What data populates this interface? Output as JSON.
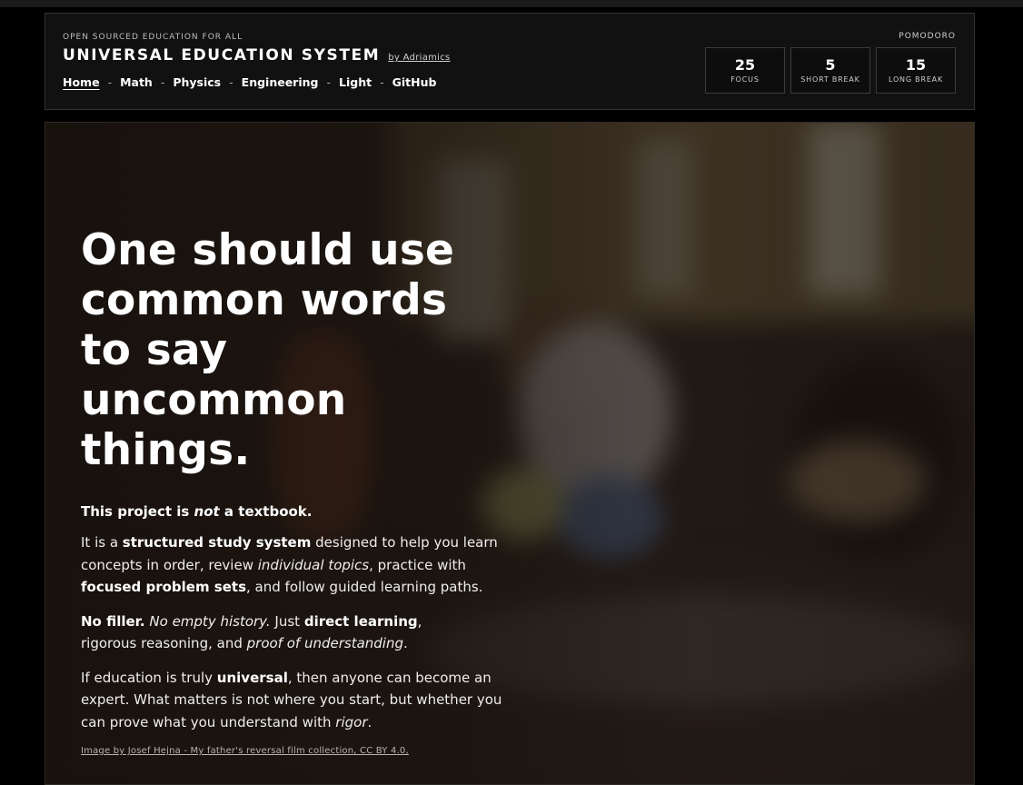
{
  "header": {
    "kicker": "OPEN SOURCED EDUCATION FOR ALL",
    "title": "UNIVERSAL EDUCATION SYSTEM",
    "byline": "by Adriamics",
    "nav": [
      {
        "label": "Home"
      },
      {
        "label": "Math"
      },
      {
        "label": "Physics"
      },
      {
        "label": "Engineering"
      },
      {
        "label": "Light"
      },
      {
        "label": "GitHub"
      }
    ],
    "nav_separator": "-"
  },
  "pomodoro": {
    "label": "POMODORO",
    "timers": [
      {
        "minutes": "25",
        "caption": "FOCUS"
      },
      {
        "minutes": "5",
        "caption": "SHORT BREAK"
      },
      {
        "minutes": "15",
        "caption": "LONG BREAK"
      }
    ]
  },
  "hero": {
    "headline": "One should use common words to say uncommon things.",
    "lead": {
      "a": "This project is ",
      "b": "not",
      "c": " a textbook."
    },
    "p1": {
      "a": "It is a ",
      "b": "structured study system",
      "c": " designed to help you learn concepts in order, review ",
      "d": "individual topics",
      "e": ", practice with ",
      "f": "focused problem sets",
      "g": ", and follow guided learning paths."
    },
    "p2": {
      "a": "No filler.",
      "b": " ",
      "c": "No empty history.",
      "d": " Just ",
      "e": "direct learning",
      "f": ",",
      "g": " rigorous reasoning, and ",
      "h": "proof of understanding",
      "i": "."
    },
    "p3": {
      "a": "If education is truly ",
      "b": "universal",
      "c": ", then anyone can become an expert. What matters is not where you start, but whether you can prove what you understand with ",
      "d": "rigor",
      "e": "."
    },
    "credit": "Image by Josef Hejna - My father's reversal film collection, CC BY 4.0,"
  }
}
